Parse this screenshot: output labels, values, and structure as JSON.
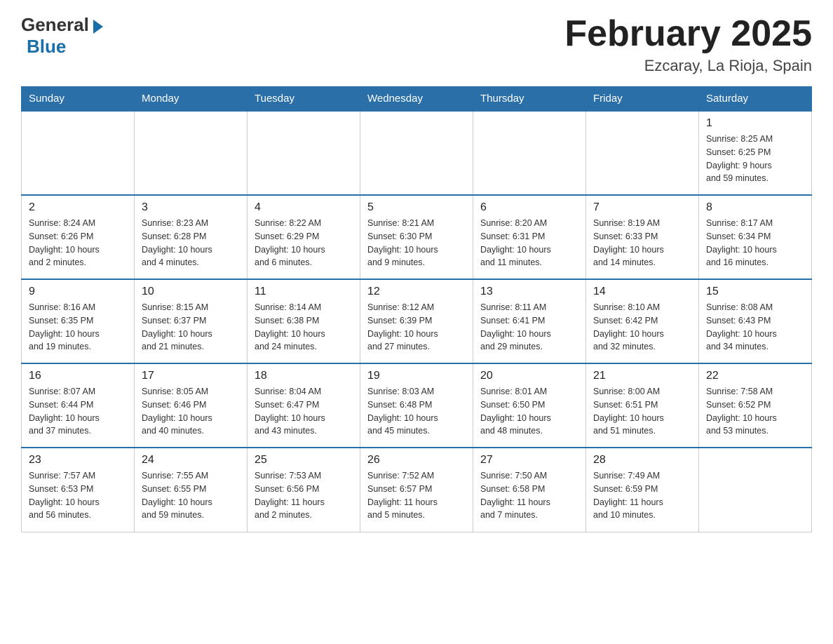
{
  "logo": {
    "general": "General",
    "blue": "Blue"
  },
  "title": "February 2025",
  "location": "Ezcaray, La Rioja, Spain",
  "weekdays": [
    "Sunday",
    "Monday",
    "Tuesday",
    "Wednesday",
    "Thursday",
    "Friday",
    "Saturday"
  ],
  "weeks": [
    [
      {
        "day": "",
        "info": ""
      },
      {
        "day": "",
        "info": ""
      },
      {
        "day": "",
        "info": ""
      },
      {
        "day": "",
        "info": ""
      },
      {
        "day": "",
        "info": ""
      },
      {
        "day": "",
        "info": ""
      },
      {
        "day": "1",
        "info": "Sunrise: 8:25 AM\nSunset: 6:25 PM\nDaylight: 9 hours\nand 59 minutes."
      }
    ],
    [
      {
        "day": "2",
        "info": "Sunrise: 8:24 AM\nSunset: 6:26 PM\nDaylight: 10 hours\nand 2 minutes."
      },
      {
        "day": "3",
        "info": "Sunrise: 8:23 AM\nSunset: 6:28 PM\nDaylight: 10 hours\nand 4 minutes."
      },
      {
        "day": "4",
        "info": "Sunrise: 8:22 AM\nSunset: 6:29 PM\nDaylight: 10 hours\nand 6 minutes."
      },
      {
        "day": "5",
        "info": "Sunrise: 8:21 AM\nSunset: 6:30 PM\nDaylight: 10 hours\nand 9 minutes."
      },
      {
        "day": "6",
        "info": "Sunrise: 8:20 AM\nSunset: 6:31 PM\nDaylight: 10 hours\nand 11 minutes."
      },
      {
        "day": "7",
        "info": "Sunrise: 8:19 AM\nSunset: 6:33 PM\nDaylight: 10 hours\nand 14 minutes."
      },
      {
        "day": "8",
        "info": "Sunrise: 8:17 AM\nSunset: 6:34 PM\nDaylight: 10 hours\nand 16 minutes."
      }
    ],
    [
      {
        "day": "9",
        "info": "Sunrise: 8:16 AM\nSunset: 6:35 PM\nDaylight: 10 hours\nand 19 minutes."
      },
      {
        "day": "10",
        "info": "Sunrise: 8:15 AM\nSunset: 6:37 PM\nDaylight: 10 hours\nand 21 minutes."
      },
      {
        "day": "11",
        "info": "Sunrise: 8:14 AM\nSunset: 6:38 PM\nDaylight: 10 hours\nand 24 minutes."
      },
      {
        "day": "12",
        "info": "Sunrise: 8:12 AM\nSunset: 6:39 PM\nDaylight: 10 hours\nand 27 minutes."
      },
      {
        "day": "13",
        "info": "Sunrise: 8:11 AM\nSunset: 6:41 PM\nDaylight: 10 hours\nand 29 minutes."
      },
      {
        "day": "14",
        "info": "Sunrise: 8:10 AM\nSunset: 6:42 PM\nDaylight: 10 hours\nand 32 minutes."
      },
      {
        "day": "15",
        "info": "Sunrise: 8:08 AM\nSunset: 6:43 PM\nDaylight: 10 hours\nand 34 minutes."
      }
    ],
    [
      {
        "day": "16",
        "info": "Sunrise: 8:07 AM\nSunset: 6:44 PM\nDaylight: 10 hours\nand 37 minutes."
      },
      {
        "day": "17",
        "info": "Sunrise: 8:05 AM\nSunset: 6:46 PM\nDaylight: 10 hours\nand 40 minutes."
      },
      {
        "day": "18",
        "info": "Sunrise: 8:04 AM\nSunset: 6:47 PM\nDaylight: 10 hours\nand 43 minutes."
      },
      {
        "day": "19",
        "info": "Sunrise: 8:03 AM\nSunset: 6:48 PM\nDaylight: 10 hours\nand 45 minutes."
      },
      {
        "day": "20",
        "info": "Sunrise: 8:01 AM\nSunset: 6:50 PM\nDaylight: 10 hours\nand 48 minutes."
      },
      {
        "day": "21",
        "info": "Sunrise: 8:00 AM\nSunset: 6:51 PM\nDaylight: 10 hours\nand 51 minutes."
      },
      {
        "day": "22",
        "info": "Sunrise: 7:58 AM\nSunset: 6:52 PM\nDaylight: 10 hours\nand 53 minutes."
      }
    ],
    [
      {
        "day": "23",
        "info": "Sunrise: 7:57 AM\nSunset: 6:53 PM\nDaylight: 10 hours\nand 56 minutes."
      },
      {
        "day": "24",
        "info": "Sunrise: 7:55 AM\nSunset: 6:55 PM\nDaylight: 10 hours\nand 59 minutes."
      },
      {
        "day": "25",
        "info": "Sunrise: 7:53 AM\nSunset: 6:56 PM\nDaylight: 11 hours\nand 2 minutes."
      },
      {
        "day": "26",
        "info": "Sunrise: 7:52 AM\nSunset: 6:57 PM\nDaylight: 11 hours\nand 5 minutes."
      },
      {
        "day": "27",
        "info": "Sunrise: 7:50 AM\nSunset: 6:58 PM\nDaylight: 11 hours\nand 7 minutes."
      },
      {
        "day": "28",
        "info": "Sunrise: 7:49 AM\nSunset: 6:59 PM\nDaylight: 11 hours\nand 10 minutes."
      },
      {
        "day": "",
        "info": ""
      }
    ]
  ]
}
